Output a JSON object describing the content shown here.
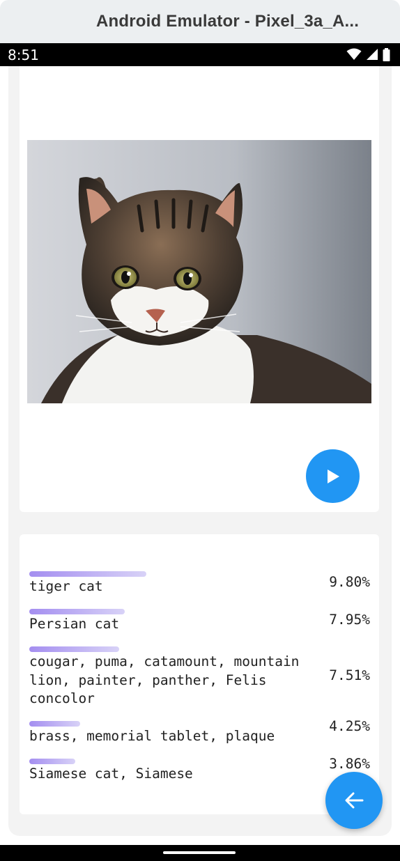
{
  "window": {
    "title": "Android Emulator - Pixel_3a_A..."
  },
  "status_bar": {
    "time": "8:51",
    "icons": [
      "wifi-icon",
      "signal-icon",
      "battery-icon"
    ]
  },
  "colors": {
    "fab_blue": "#2196f3",
    "bar_start": "#a48ef0",
    "bar_end": "#d8d2f7"
  },
  "image": {
    "subject": "tabby cat photo"
  },
  "results": [
    {
      "label": "tiger cat",
      "percent": "9.80%",
      "confidence": 0.098
    },
    {
      "label": "Persian cat",
      "percent": "7.95%",
      "confidence": 0.0795
    },
    {
      "label": "cougar, puma, catamount, mountain lion, painter, panther, Felis concolor",
      "percent": "7.51%",
      "confidence": 0.0751
    },
    {
      "label": "brass, memorial tablet, plaque",
      "percent": "4.25%",
      "confidence": 0.0425
    },
    {
      "label": "Siamese cat, Siamese",
      "percent": "3.86%",
      "confidence": 0.0386
    }
  ],
  "buttons": {
    "play": "play-icon",
    "back": "arrow-back-icon"
  }
}
